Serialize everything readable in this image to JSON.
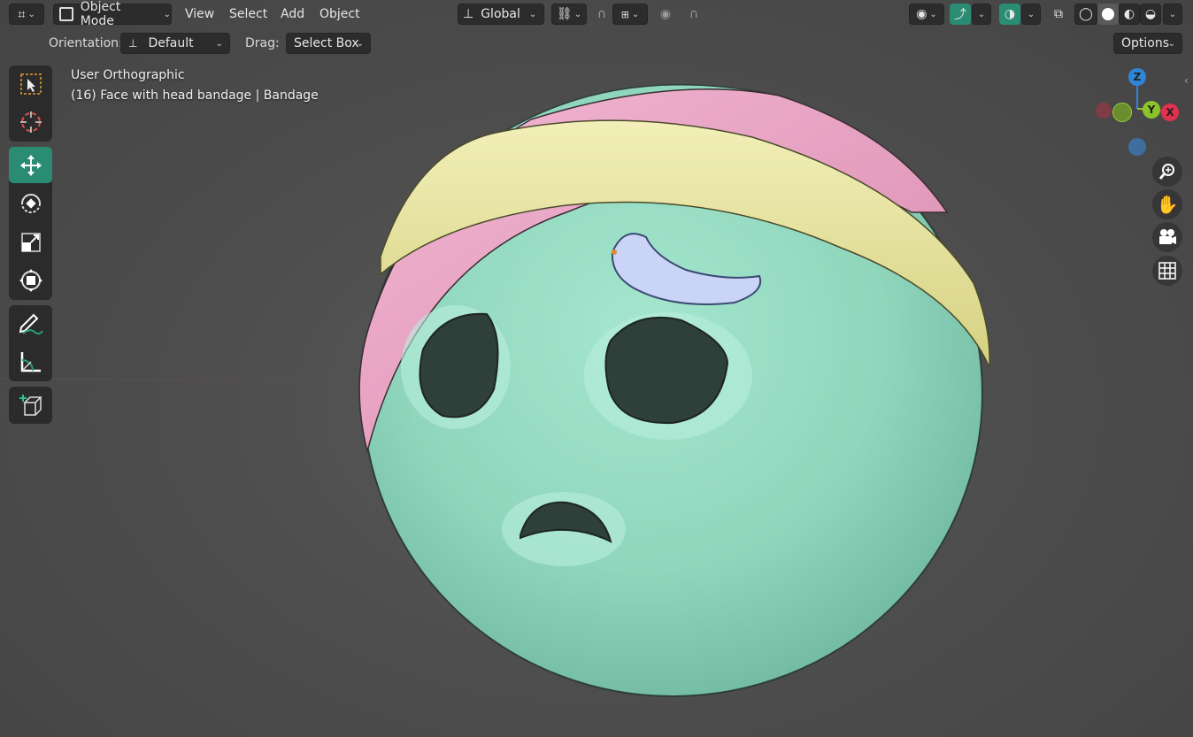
{
  "header": {
    "mode_label": "Object Mode",
    "menus": [
      "View",
      "Select",
      "Add",
      "Object"
    ],
    "transform_orientation": "Global",
    "options_label": "Options"
  },
  "tool_settings": {
    "orientation_label": "Orientation:",
    "orientation_value": "Default",
    "drag_label": "Drag:",
    "drag_value": "Select Box"
  },
  "viewport": {
    "view_name": "User Orthographic",
    "object_info": "(16) Face with head bandage | Bandage"
  },
  "gizmo": {
    "z_label": "Z",
    "y_label": "Y",
    "x_label": "X"
  },
  "colors": {
    "accent_active": "#2a8c72",
    "face": "#8fd6bd",
    "bandage": "#e4e19a",
    "scarf": "#e8a5c4",
    "sweat": "#c9d4f6",
    "axis_x": "#e0314e",
    "axis_y": "#8ac42a",
    "axis_z": "#2f86d8"
  },
  "icons": {
    "editor_type": "editor-type-icon",
    "mode": "object-mode-icon",
    "select_box": "select-box-tool-icon",
    "cursor": "cursor-tool-icon",
    "move": "move-tool-icon",
    "rotate": "rotate-tool-icon",
    "scale": "scale-tool-icon",
    "transform": "transform-tool-icon",
    "annotate": "annotate-tool-icon",
    "measure": "measure-tool-icon",
    "add_cube": "add-cube-tool-icon"
  }
}
